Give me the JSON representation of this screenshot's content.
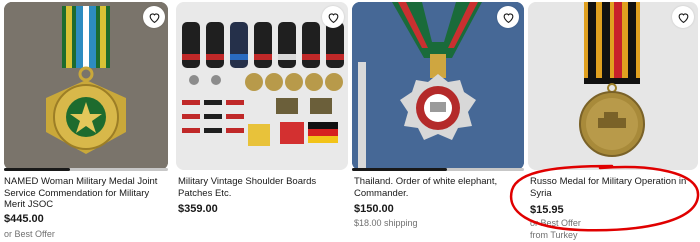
{
  "listings": [
    {
      "title": "NAMED Woman Military Medal Joint Service Commendation for Military Merit JSOC",
      "price": "$445.00",
      "note": "or Best Offer",
      "note2": "",
      "image_progress": 0.4
    },
    {
      "title": "Military Vintage Shoulder Boards Patches Etc.",
      "price": "$359.00",
      "note": "",
      "note2": "",
      "image_progress": 0
    },
    {
      "title": "Thailand. Order of white elephant, Commander.",
      "price": "$150.00",
      "note": "$18.00 shipping",
      "note2": "",
      "image_progress": 0.55
    },
    {
      "title": "Russo Medal for Military Operation in Syria",
      "price": "$15.95",
      "note": "or Best Offer",
      "note2": "from Turkey",
      "image_progress": 0
    }
  ],
  "icons": {
    "watch": "heart-icon"
  },
  "colors": {
    "annotation": "#e00000",
    "progress_fill": "#191919"
  }
}
